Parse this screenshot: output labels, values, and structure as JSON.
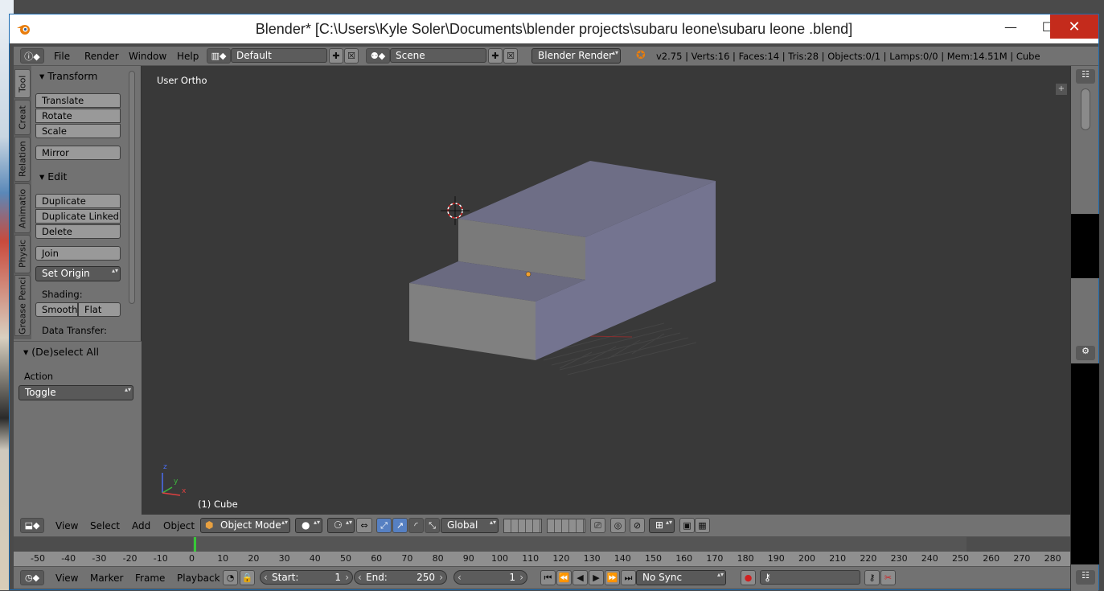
{
  "window": {
    "title": "Blender* [C:\\Users\\Kyle Soler\\Documents\\blender projects\\subaru leone\\subaru leone .blend]",
    "min": "—",
    "max": "☐",
    "close": "✕"
  },
  "info_header": {
    "menus": [
      "File",
      "Render",
      "Window",
      "Help"
    ],
    "layout": "Default",
    "scene": "Scene",
    "engine": "Blender Render",
    "stats": "v2.75 | Verts:16 | Faces:14 | Tris:28 | Objects:0/1 | Lamps:0/0 | Mem:14.51M | Cube"
  },
  "tabs": [
    "Tool",
    "Creat",
    "Relation",
    "Animatio",
    "Physic",
    "Grease Penci"
  ],
  "tools": {
    "transform_title": "Transform",
    "transform": [
      "Translate",
      "Rotate",
      "Scale"
    ],
    "mirror": "Mirror",
    "edit_title": "Edit",
    "edit": [
      "Duplicate",
      "Duplicate Linked",
      "Delete"
    ],
    "join": "Join",
    "set_origin": "Set Origin",
    "shading_label": "Shading:",
    "smooth": "Smooth",
    "flat": "Flat",
    "data_transfer": "Data Transfer:"
  },
  "operator": {
    "title": "(De)select All",
    "action_label": "Action",
    "action_value": "Toggle"
  },
  "viewport": {
    "view_name": "User Ortho",
    "object_name": "(1) Cube",
    "axis_x": "x",
    "axis_y": "y",
    "axis_z": "z"
  },
  "view3d_header": {
    "menus": [
      "View",
      "Select",
      "Add",
      "Object"
    ],
    "mode": "Object Mode",
    "orientation": "Global"
  },
  "timeline": {
    "ticks": [
      "-50",
      "-40",
      "-30",
      "-20",
      "-10",
      "0",
      "10",
      "20",
      "30",
      "40",
      "50",
      "60",
      "70",
      "80",
      "90",
      "100",
      "110",
      "120",
      "130",
      "140",
      "150",
      "160",
      "170",
      "180",
      "190",
      "200",
      "210",
      "220",
      "230",
      "240",
      "250",
      "260",
      "270",
      "280"
    ],
    "current_frame_marker": 0
  },
  "timeline_header": {
    "menus": [
      "View",
      "Marker",
      "Frame",
      "Playback"
    ],
    "start_label": "Start:",
    "start": "1",
    "end_label": "End:",
    "end": "250",
    "current": "1",
    "sync": "No Sync"
  },
  "colors": {
    "accent": "#5680c2",
    "close": "#c42b1c",
    "frame": "#37c837",
    "blender_orange": "#e87d0d"
  }
}
